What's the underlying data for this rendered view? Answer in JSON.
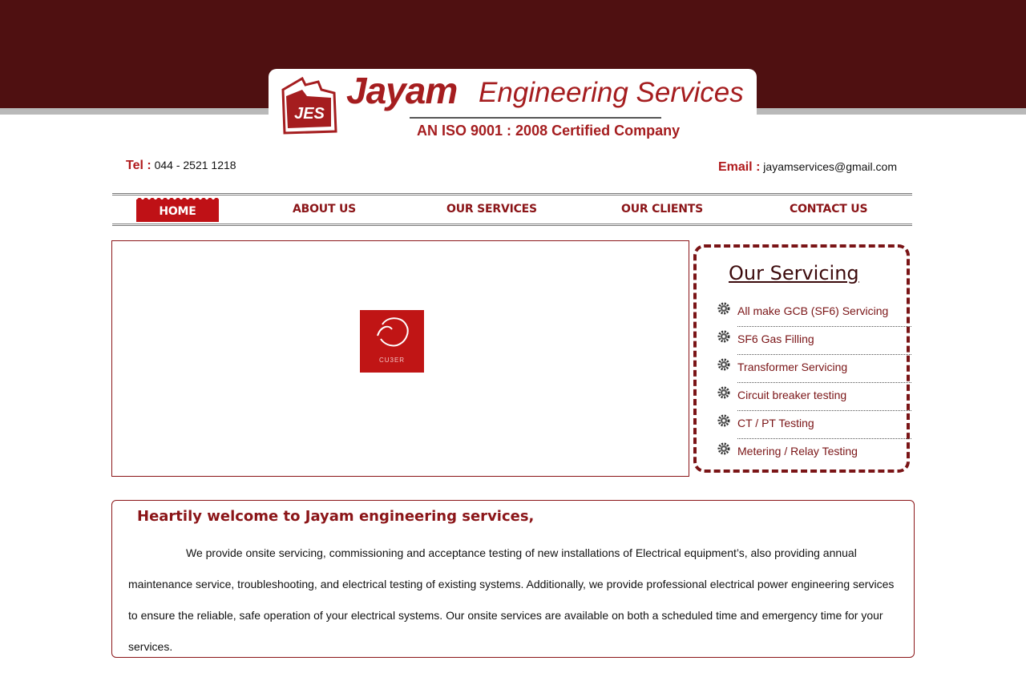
{
  "header": {
    "brand_name": "Jayam",
    "brand_tail": "Engineering Services",
    "logo_text": "JES",
    "tagline": "AN ISO 9001 : 2008 Certified Company"
  },
  "contact": {
    "tel_label": "Tel :",
    "tel_value": "044 - 2521 1218",
    "email_label": "Email :",
    "email_value": "jayamservices@gmail.com"
  },
  "nav": {
    "home": "HOME",
    "about": "ABOUT US",
    "services": "OUR SERVICES",
    "clients": "OUR CLIENTS",
    "contact": "CONTACT US"
  },
  "slider": {
    "caption": "CU3ER"
  },
  "servicing": {
    "title": "Our Servicing",
    "items": [
      "All make GCB (SF6) Servicing",
      "SF6 Gas Filling",
      "Transformer Servicing",
      "Circuit breaker testing",
      "CT / PT Testing",
      "Metering / Relay Testing"
    ]
  },
  "welcome": {
    "title": "Heartily welcome to Jayam engineering services,",
    "body": "We provide onsite servicing, commissioning and acceptance testing of new installations of Electrical equipment’s, also providing annual maintenance service, troubleshooting, and electrical testing of existing systems. Additionally, we provide professional electrical power engineering services to ensure the reliable, safe operation of your electrical systems. Our onsite services are available on both a scheduled time and emergency time for your services."
  },
  "colors": {
    "brand": "#a51d1f",
    "band": "#4f1011",
    "nav_active": "#bf1116"
  }
}
